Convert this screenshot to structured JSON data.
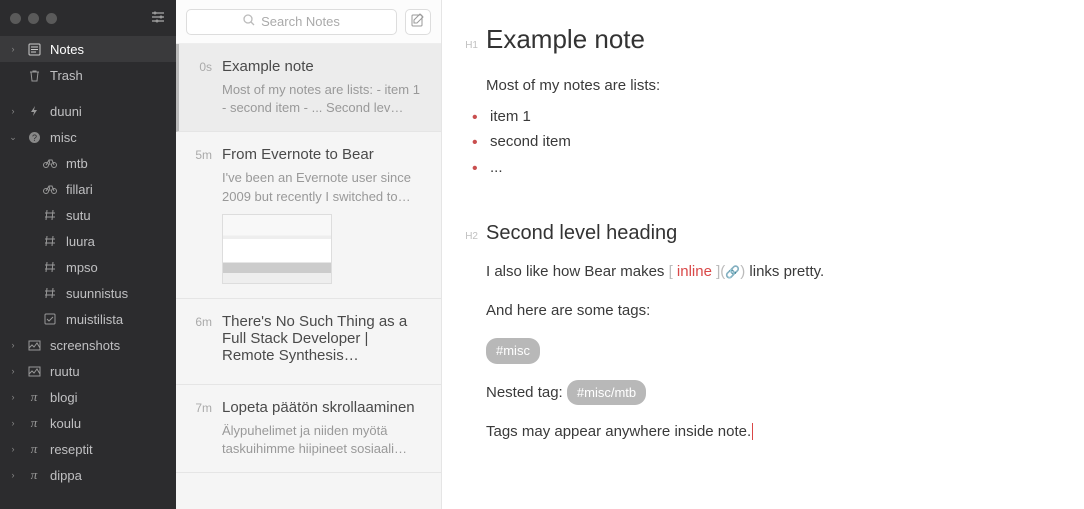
{
  "search": {
    "placeholder": "Search Notes"
  },
  "sidebar": {
    "notes_label": "Notes",
    "trash_label": "Trash",
    "tags": [
      {
        "label": "duuni",
        "icon": "bolt",
        "expandable": true
      },
      {
        "label": "misc",
        "icon": "question",
        "expanded": true,
        "children": [
          {
            "label": "mtb",
            "icon": "bike"
          },
          {
            "label": "fillari",
            "icon": "bike"
          },
          {
            "label": "sutu",
            "icon": "hash"
          },
          {
            "label": "luura",
            "icon": "hash"
          },
          {
            "label": "mpso",
            "icon": "hash"
          },
          {
            "label": "suunnistus",
            "icon": "hash"
          },
          {
            "label": "muistilista",
            "icon": "check"
          }
        ]
      },
      {
        "label": "screenshots",
        "icon": "image",
        "expandable": true
      },
      {
        "label": "ruutu",
        "icon": "image",
        "expandable": true
      },
      {
        "label": "blogi",
        "icon": "pi",
        "expandable": true
      },
      {
        "label": "koulu",
        "icon": "pi",
        "expandable": true
      },
      {
        "label": "reseptit",
        "icon": "pi",
        "expandable": true
      },
      {
        "label": "dippa",
        "icon": "pi",
        "expandable": true
      }
    ]
  },
  "notes": [
    {
      "time": "0s",
      "title": "Example note",
      "preview": "Most of my notes are lists: - item 1 - second item - ... Second lev…",
      "selected": true
    },
    {
      "time": "5m",
      "title": "From Evernote to Bear",
      "preview": "I've been an Evernote user since 2009 but recently I switched to…",
      "thumb": true
    },
    {
      "time": "6m",
      "title": "There's No Such Thing as a Full Stack Developer | Remote Synthesis…",
      "preview": ""
    },
    {
      "time": "7m",
      "title": "Lopeta päätön skrollaaminen",
      "preview": "Älypuhelimet ja niiden myötä taskuihimme hiipineet sosiaali…"
    }
  ],
  "editor": {
    "h1_marker": "H1",
    "h2_marker": "H2",
    "title": "Example note",
    "intro": "Most of my notes are lists:",
    "items": [
      "item 1",
      "second item",
      "..."
    ],
    "h2": "Second level heading",
    "link_sentence_pre": "I also like how Bear makes ",
    "link_text": "inline",
    "link_sentence_post": " links pretty.",
    "tags_intro": "And here are some tags:",
    "tag1": "#misc",
    "nested_pre": "Nested tag: ",
    "tag2": "#misc/mtb",
    "closing": "Tags may appear anywhere inside note."
  }
}
